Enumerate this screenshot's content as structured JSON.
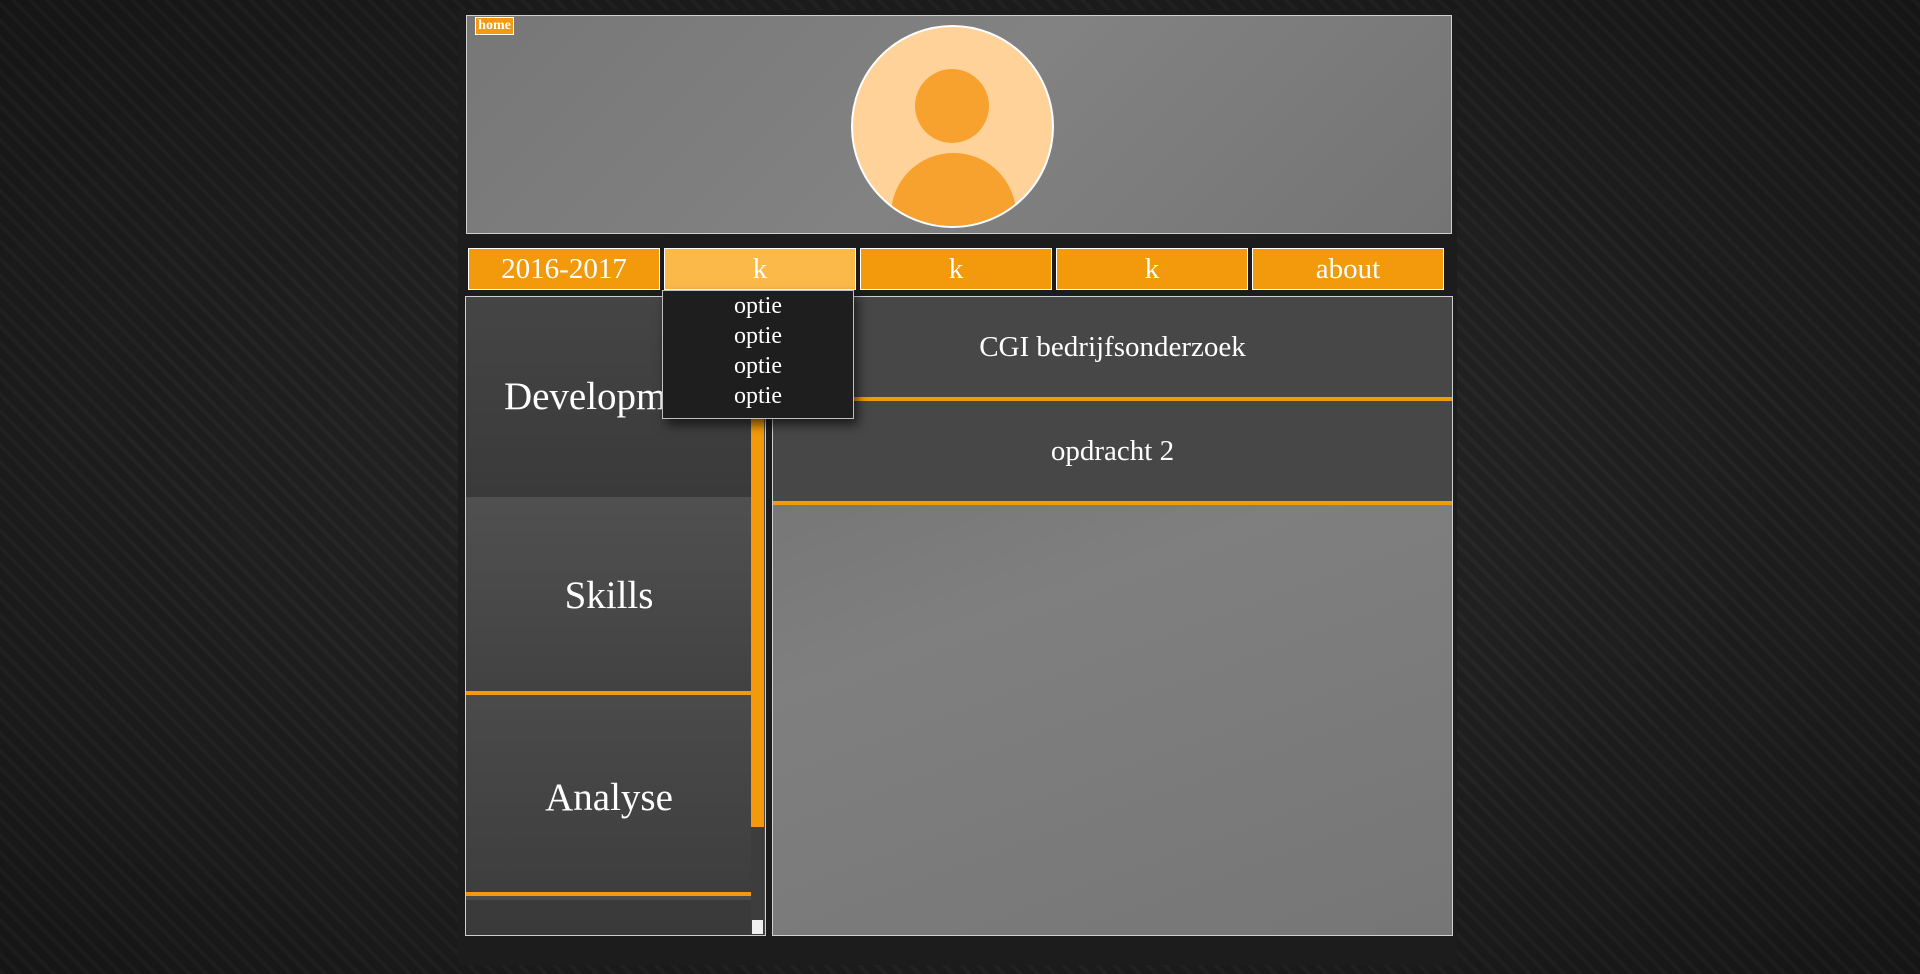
{
  "header": {
    "home_label": "home"
  },
  "nav": {
    "items": [
      {
        "label": "2016-2017"
      },
      {
        "label": "k"
      },
      {
        "label": "k"
      },
      {
        "label": "k"
      },
      {
        "label": "about"
      }
    ],
    "dropdown": [
      "optie",
      "optie",
      "optie",
      "optie"
    ]
  },
  "sidebar": {
    "items": [
      {
        "label": "Development"
      },
      {
        "label": "Skills"
      },
      {
        "label": "Analyse"
      }
    ]
  },
  "content": {
    "items": [
      {
        "label": "CGI bedrijfsonderzoek"
      },
      {
        "label": "opdracht 2"
      }
    ]
  },
  "colors": {
    "accent": "#f39a0c",
    "accent_light": "#fbb94a",
    "panel": "#7a7a7a"
  }
}
